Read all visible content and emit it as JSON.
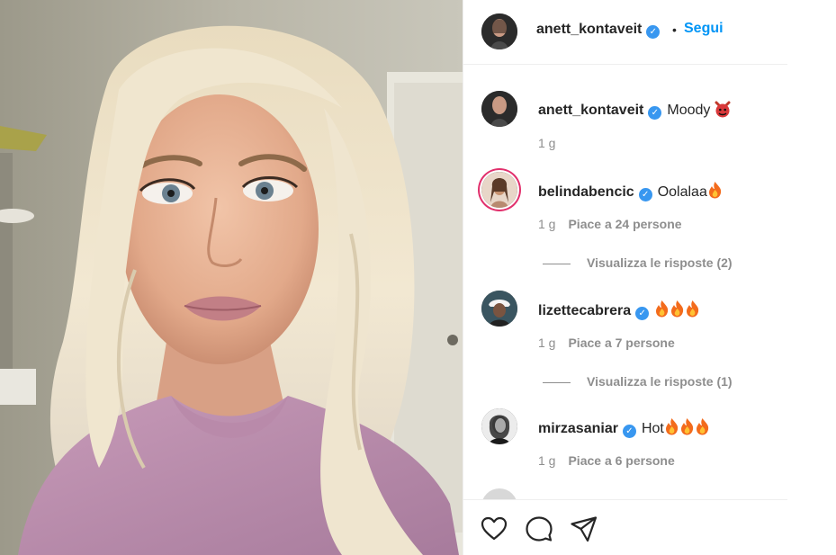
{
  "post": {
    "author": "anett_kontaveit",
    "follow_label": "Segui",
    "separator": "•"
  },
  "caption": {
    "username": "anett_kontaveit",
    "text": "Moody",
    "time": "1 g"
  },
  "comments": [
    {
      "username": "belindabencic",
      "text": "Oolalaa",
      "fires": 1,
      "time": "1 g",
      "likes": "Piace a 24 persone",
      "replies": "Visualizza le risposte (2)",
      "ring": true
    },
    {
      "username": "lizettecabrera",
      "text": "",
      "fires": 3,
      "time": "1 g",
      "likes": "Piace a 7 persone",
      "replies": "Visualizza le risposte (1)",
      "ring": false
    },
    {
      "username": "mirzasaniar",
      "text": "Hot",
      "fires": 3,
      "time": "1 g",
      "likes": "Piace a 6 persone",
      "replies": "",
      "ring": false
    }
  ],
  "icons": {
    "verified": "verified-badge-icon",
    "like": "heart-icon",
    "comment": "comment-bubble-icon",
    "share": "paper-plane-icon",
    "fire": "fire-emoji-icon",
    "devil": "devil-emoji-icon"
  },
  "colors": {
    "link": "#0095f6",
    "verified": "#3897f0",
    "muted": "#8e8e8e",
    "text": "#262626",
    "divider": "#efefef"
  }
}
